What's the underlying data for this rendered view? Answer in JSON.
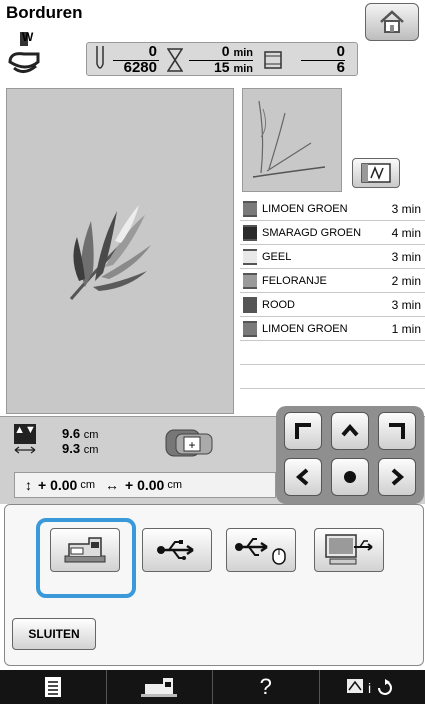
{
  "header": {
    "title": "Borduren",
    "presser_letter": "W"
  },
  "counters": {
    "stitch_current": "0",
    "stitch_total": "6280",
    "time_current": "0",
    "time_total": "15",
    "time_unit": "min",
    "color_current": "0",
    "color_total": "6"
  },
  "threads": [
    {
      "name": "LIMOEN GROEN",
      "time": "3 min",
      "color": "#7a7a7a"
    },
    {
      "name": "SMARAGD GROEN",
      "time": "4 min",
      "color": "#2a2a2a"
    },
    {
      "name": "GEEL",
      "time": "3 min",
      "color": "#e8e8e8"
    },
    {
      "name": "FELORANJE",
      "time": "2 min",
      "color": "#9a9a9a"
    },
    {
      "name": "ROOD",
      "time": "3 min",
      "color": "#555555"
    },
    {
      "name": "LIMOEN GROEN",
      "time": "1 min",
      "color": "#7a7a7a"
    }
  ],
  "size": {
    "height": "9.6",
    "width": "9.3",
    "unit": "cm"
  },
  "offset": {
    "vertical": "+ 0.00",
    "horizontal": "+ 0.00",
    "unit": "cm"
  },
  "popup": {
    "close_label": "SLUITEN",
    "selected_option": "machine"
  },
  "bottom_bar": {
    "help_label": "?"
  },
  "colors": {
    "selection_accent": "#3a9ad9",
    "bottom_bar": "#141414",
    "canvas": "#c8c8c8"
  }
}
